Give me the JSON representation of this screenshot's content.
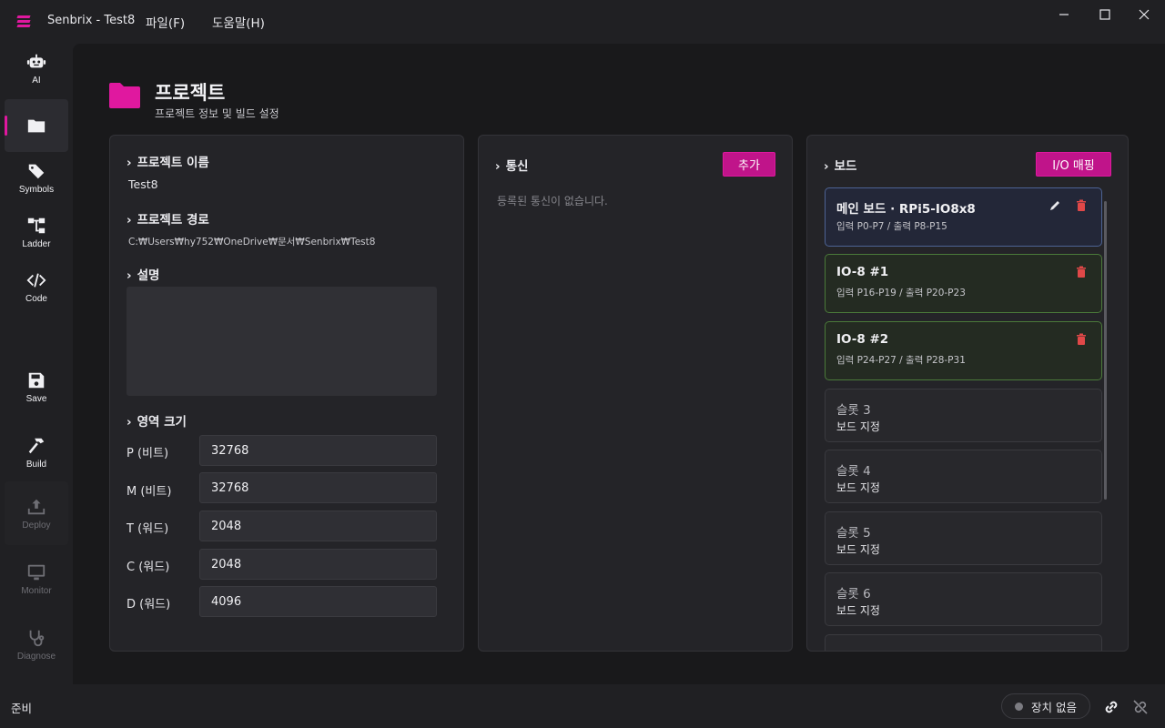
{
  "app": {
    "title": "Senbrix - Test8",
    "menus": [
      "파일(F)",
      "도움말(H)"
    ],
    "brand_color": "#e0189f"
  },
  "sidebar": {
    "items": [
      {
        "label": "AI",
        "icon": "robot-icon"
      },
      {
        "label": "",
        "icon": "folder-icon",
        "active": true
      },
      {
        "label": "Symbols",
        "icon": "tag-icon"
      },
      {
        "label": "Ladder",
        "icon": "ladder-icon"
      },
      {
        "label": "Code",
        "icon": "code-icon"
      },
      {
        "label": "Save",
        "icon": "save-icon"
      },
      {
        "label": "Build",
        "icon": "hammer-icon"
      },
      {
        "label": "Deploy",
        "icon": "upload-icon",
        "disabled": true
      },
      {
        "label": "Monitor",
        "icon": "monitor-icon",
        "disabled": true
      },
      {
        "label": "Diagnose",
        "icon": "stethoscope-icon",
        "disabled": true
      }
    ]
  },
  "page": {
    "title": "프로젝트",
    "subtitle": "프로젝트 정보 및 빌드 설정"
  },
  "project": {
    "name_heading": "프로젝트 이름",
    "name": "Test8",
    "path_heading": "프로젝트 경로",
    "path": "C:₩Users₩hy752₩OneDrive₩문서₩Senbrix₩Test8",
    "desc_heading": "설명",
    "area_heading": "영역 크기",
    "areas": [
      {
        "label": "P (비트)",
        "value": "32768"
      },
      {
        "label": "M (비트)",
        "value": "32768"
      },
      {
        "label": "T (워드)",
        "value": "2048"
      },
      {
        "label": "C (워드)",
        "value": "2048"
      },
      {
        "label": "D (워드)",
        "value": "4096"
      }
    ]
  },
  "comm": {
    "heading": "통신",
    "add_label": "추가",
    "empty": "등록된 통신이 없습니다."
  },
  "board": {
    "heading": "보드",
    "io_map_label": "I/O 매핑",
    "cards": [
      {
        "title": "메인 보드 · RPi5-IO8x8",
        "sub": "입력 P0-P7 / 출력 P8-P15"
      },
      {
        "title": "IO-8 #1",
        "sub": "입력 P16-P19 / 출력 P20-P23"
      },
      {
        "title": "IO-8 #2",
        "sub": "입력 P24-P27 / 출력 P28-P31"
      },
      {
        "title": "슬롯 3",
        "sub": "보드 지정"
      },
      {
        "title": "슬롯 4",
        "sub": "보드 지정"
      },
      {
        "title": "슬롯 5",
        "sub": "보드 지정"
      },
      {
        "title": "슬롯 6",
        "sub": "보드 지정"
      }
    ]
  },
  "status": {
    "text": "준비",
    "device": "장치 없음"
  }
}
